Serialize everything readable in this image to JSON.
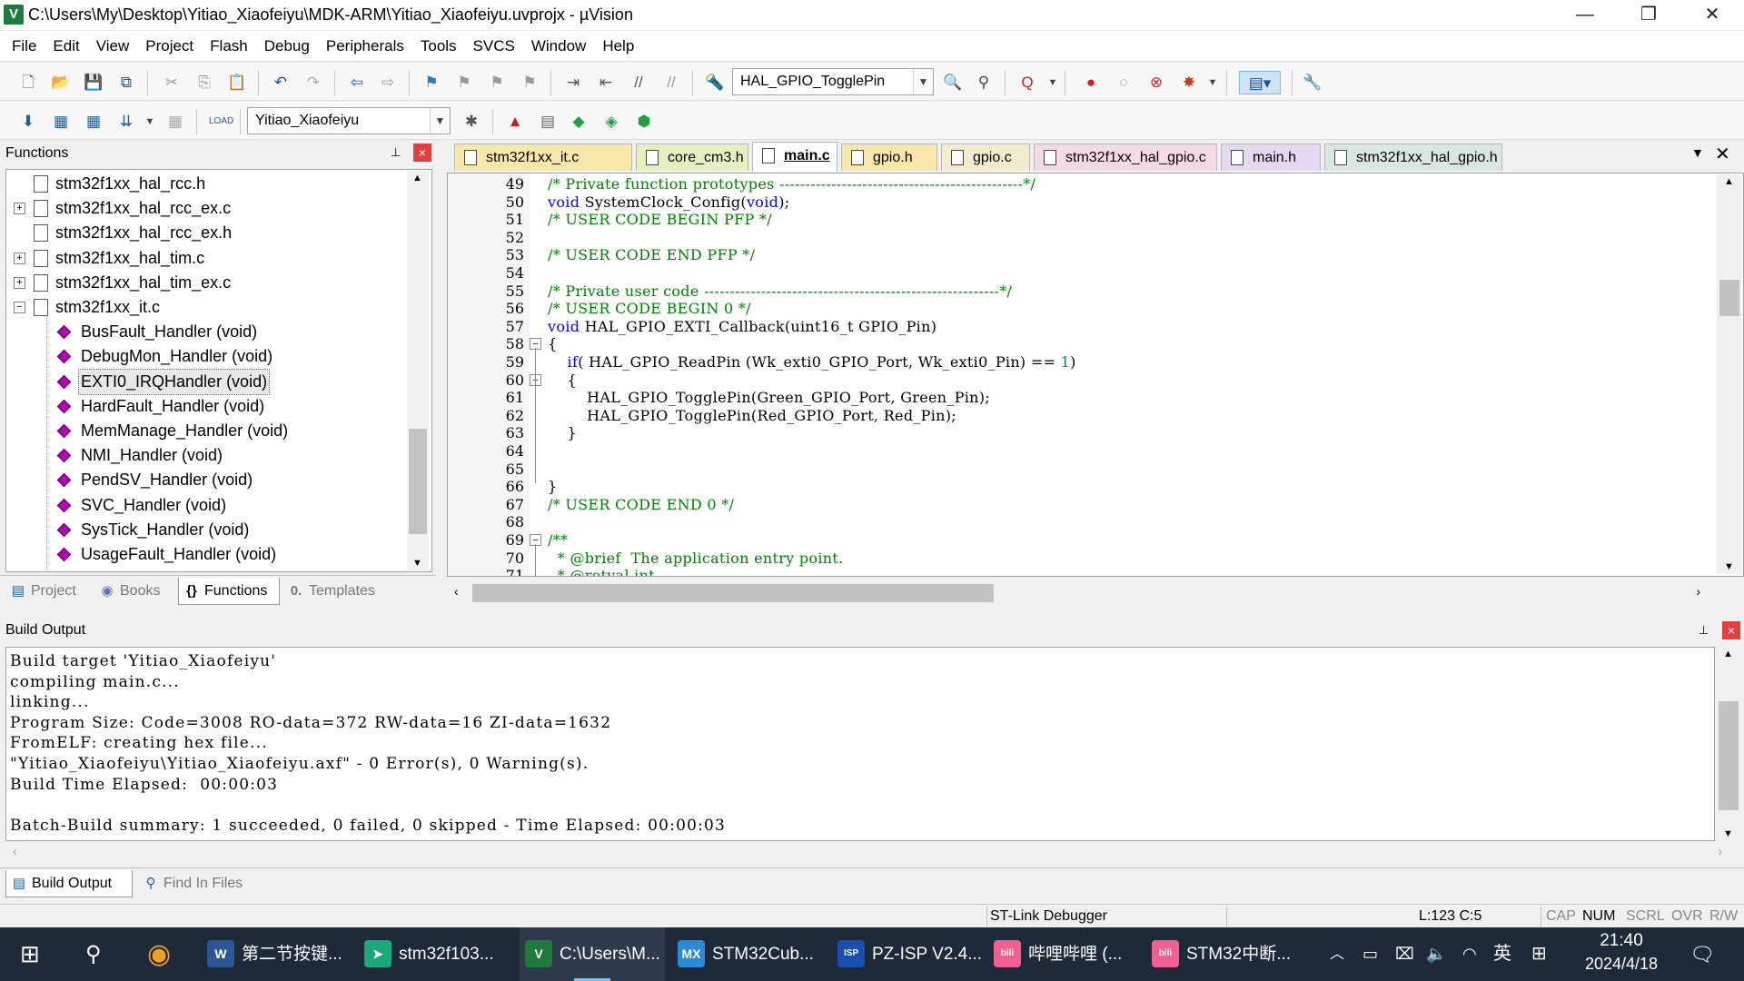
{
  "window": {
    "title": "C:\\Users\\My\\Desktop\\Yitiao_Xiaofeiyu\\MDK-ARM\\Yitiao_Xiaofeiyu.uvprojx - µVision",
    "minimize": "—",
    "restore": "❐",
    "close": "✕"
  },
  "menu": [
    "File",
    "Edit",
    "View",
    "Project",
    "Flash",
    "Debug",
    "Peripherals",
    "Tools",
    "SVCS",
    "Window",
    "Help"
  ],
  "toolbar": {
    "find_combo": "HAL_GPIO_TogglePin",
    "target_combo": "Yitiao_Xiaofeiyu"
  },
  "functions_panel": {
    "title": "Functions",
    "pin": "⊥",
    "close": "×",
    "items": [
      {
        "label": "stm32f1xx_hal_rcc.h",
        "kind": "file",
        "expander": ""
      },
      {
        "label": "stm32f1xx_hal_rcc_ex.c",
        "kind": "file",
        "expander": "+"
      },
      {
        "label": "stm32f1xx_hal_rcc_ex.h",
        "kind": "file",
        "expander": ""
      },
      {
        "label": "stm32f1xx_hal_tim.c",
        "kind": "file",
        "expander": "+"
      },
      {
        "label": "stm32f1xx_hal_tim_ex.c",
        "kind": "file",
        "expander": "+"
      },
      {
        "label": "stm32f1xx_it.c",
        "kind": "file",
        "expander": "−"
      },
      {
        "label": "BusFault_Handler (void)",
        "kind": "func"
      },
      {
        "label": "DebugMon_Handler (void)",
        "kind": "func"
      },
      {
        "label": "EXTI0_IRQHandler (void)",
        "kind": "func",
        "selected": true
      },
      {
        "label": "HardFault_Handler (void)",
        "kind": "func"
      },
      {
        "label": "MemManage_Handler (void)",
        "kind": "func"
      },
      {
        "label": "NMI_Handler (void)",
        "kind": "func"
      },
      {
        "label": "PendSV_Handler (void)",
        "kind": "func"
      },
      {
        "label": "SVC_Handler (void)",
        "kind": "func"
      },
      {
        "label": "SysTick_Handler (void)",
        "kind": "func"
      },
      {
        "label": "UsageFault_Handler (void)",
        "kind": "func"
      }
    ],
    "tabs": [
      {
        "label": "Project",
        "icon": "project-icon"
      },
      {
        "label": "Books",
        "icon": "books-icon"
      },
      {
        "label": "Functions",
        "icon": "functions-icon",
        "active": true
      },
      {
        "label": "Templates",
        "icon": "templates-icon"
      }
    ]
  },
  "editor": {
    "tabs": [
      {
        "label": "stm32f1xx_it.c",
        "color": "#f7e7a8"
      },
      {
        "label": "core_cm3.h",
        "color": "#e4f0c0"
      },
      {
        "label": "main.c",
        "color": "#ffffff",
        "active": true
      },
      {
        "label": "gpio.h",
        "color": "#f7e7a8"
      },
      {
        "label": "gpio.c",
        "color": "#f3eccc"
      },
      {
        "label": "stm32f1xx_hal_gpio.c",
        "color": "#f4d9e8"
      },
      {
        "label": "main.h",
        "color": "#e6d8f0"
      },
      {
        "label": "stm32f1xx_hal_gpio.h",
        "color": "#d8e8e0"
      }
    ],
    "lines": [
      {
        "n": "49",
        "html": "<span class='cmt'>/* Private function prototypes -----------------------------------------------*/</span>"
      },
      {
        "n": "50",
        "html": "<span class='kw'>void</span> SystemClock_Config(<span class='kw'>void</span>);"
      },
      {
        "n": "51",
        "html": "<span class='cmt'>/* USER CODE BEGIN PFP */</span>"
      },
      {
        "n": "52",
        "html": ""
      },
      {
        "n": "53",
        "html": "<span class='cmt'>/* USER CODE END PFP */</span>"
      },
      {
        "n": "54",
        "html": ""
      },
      {
        "n": "55",
        "html": "<span class='cmt'>/* Private user code ---------------------------------------------------------*/</span>"
      },
      {
        "n": "56",
        "html": "<span class='cmt'>/* USER CODE BEGIN 0 */</span>"
      },
      {
        "n": "57",
        "html": "<span class='kw'>void</span> HAL_GPIO_EXTI_Callback(uint16_t GPIO_Pin)"
      },
      {
        "n": "58",
        "html": "{",
        "fold": "−"
      },
      {
        "n": "59",
        "html": "    <span class='kw'>if</span>( HAL_GPIO_ReadPin (Wk_exti0_GPIO_Port, Wk_exti0_Pin) == <span class='num'>1</span>)"
      },
      {
        "n": "60",
        "html": "    {",
        "fold": "−"
      },
      {
        "n": "61",
        "html": "        HAL_GPIO_TogglePin(Green_GPIO_Port, Green_Pin);"
      },
      {
        "n": "62",
        "html": "        HAL_GPIO_TogglePin(Red_GPIO_Port, Red_Pin);"
      },
      {
        "n": "63",
        "html": "    }"
      },
      {
        "n": "64",
        "html": ""
      },
      {
        "n": "65",
        "html": ""
      },
      {
        "n": "66",
        "html": "}"
      },
      {
        "n": "67",
        "html": "<span class='cmt'>/* USER CODE END 0 */</span>"
      },
      {
        "n": "68",
        "html": ""
      },
      {
        "n": "69",
        "html": "<span class='cmt'>/**</span>",
        "fold": "−"
      },
      {
        "n": "70",
        "html": "<span class='cmt'>  * @brief  The application entry point.</span>"
      },
      {
        "n": "71",
        "html": "<span class='cmt'>  * @retval int</span>"
      }
    ]
  },
  "build_output": {
    "title": "Build Output",
    "lines": [
      "Build target 'Yitiao_Xiaofeiyu'",
      "compiling main.c...",
      "linking...",
      "Program Size: Code=3008 RO-data=372 RW-data=16 ZI-data=1632",
      "FromELF: creating hex file...",
      "\"Yitiao_Xiaofeiyu\\Yitiao_Xiaofeiyu.axf\" - 0 Error(s), 0 Warning(s).",
      "Build Time Elapsed:  00:00:03",
      "",
      "Batch-Build summary: 1 succeeded, 0 failed, 0 skipped - Time Elapsed: 00:00:03"
    ],
    "tabs": [
      {
        "label": "Build Output",
        "active": true
      },
      {
        "label": "Find In Files"
      }
    ]
  },
  "status": {
    "debugger": "ST-Link Debugger",
    "position": "L:123 C:5",
    "flags": [
      "CAP",
      "NUM",
      "SCRL",
      "OVR",
      "R/W"
    ]
  },
  "taskbar": {
    "apps": [
      {
        "label": "第二节按键...",
        "icon": "W",
        "color": "#2b5797"
      },
      {
        "label": "stm32f103...",
        "icon": "➤",
        "color": "#19a97b"
      },
      {
        "label": "C:\\Users\\M...",
        "icon": "V",
        "color": "#1f7a3d",
        "active": true
      },
      {
        "label": "STM32Cub...",
        "icon": "MX",
        "color": "#2a8ad8"
      },
      {
        "label": "PZ-ISP V2.4...",
        "icon": "ISP",
        "color": "#1a4fb0"
      },
      {
        "label": "哔哩哔哩 (...",
        "icon": "bili",
        "color": "#f06090"
      },
      {
        "label": "STM32中断...",
        "icon": "bili",
        "color": "#f06090"
      }
    ],
    "ime": "英",
    "time": "21:40",
    "date": "2024/4/18"
  }
}
